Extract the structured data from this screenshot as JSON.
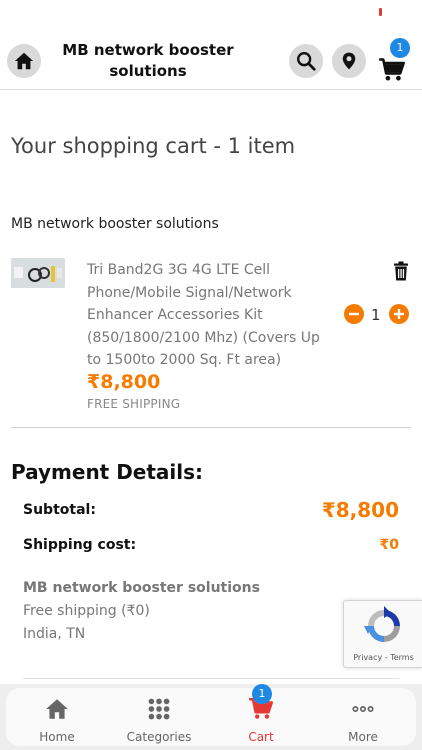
{
  "header": {
    "store_title": "MB network booster solutions",
    "cart_count": "1"
  },
  "cart": {
    "heading": "Your shopping cart - 1 item",
    "seller": "MB network booster solutions",
    "item": {
      "title": "Tri Band2G 3G 4G LTE Cell Phone/Mobile Signal/Network Enhancer Accessories Kit (850/1800/2100 Mhz) (Covers Up to 1500to 2000 Sq. Ft area)",
      "price": "₹8,800",
      "shipping_note": "FREE SHIPPING",
      "quantity": "1"
    }
  },
  "payment": {
    "title": "Payment Details:",
    "subtotal_label": "Subtotal:",
    "subtotal_value": "₹8,800",
    "shipping_label": "Shipping cost:",
    "shipping_value": "₹0"
  },
  "address": {
    "name": "MB network booster solutions",
    "shipping": "Free shipping (₹0)",
    "location": "India, TN"
  },
  "recaptcha": {
    "links": "Privacy - Terms"
  },
  "bottom_nav": {
    "items": [
      {
        "label": "Home",
        "icon": "home-icon"
      },
      {
        "label": "Categories",
        "icon": "grid-icon"
      },
      {
        "label": "Cart",
        "icon": "cart-icon"
      },
      {
        "label": "More",
        "icon": "more-dots-icon"
      }
    ],
    "cart_badge": "1"
  },
  "colors": {
    "accent": "#f57c00",
    "active_nav": "#e53935",
    "badge": "#1e88e5"
  }
}
